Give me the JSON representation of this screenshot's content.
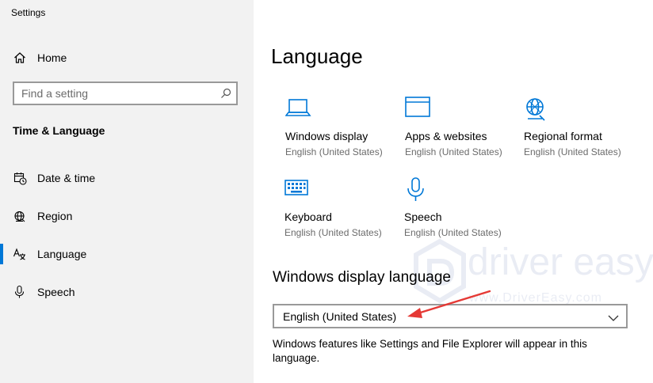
{
  "window": {
    "title": "Settings"
  },
  "sidebar": {
    "home_label": "Home",
    "search_placeholder": "Find a setting",
    "section_heading": "Time & Language",
    "items": [
      {
        "label": "Date & time",
        "icon": "calendar-clock-icon"
      },
      {
        "label": "Region",
        "icon": "globe-icon"
      },
      {
        "label": "Language",
        "icon": "language-icon",
        "active": true
      },
      {
        "label": "Speech",
        "icon": "microphone-icon"
      }
    ]
  },
  "main": {
    "title": "Language",
    "tiles": [
      {
        "name": "Windows display",
        "sub": "English (United States)",
        "icon": "laptop-icon"
      },
      {
        "name": "Apps & websites",
        "sub": "English (United States)",
        "icon": "browser-window-icon"
      },
      {
        "name": "Regional format",
        "sub": "English (United States)",
        "icon": "globe-icon"
      },
      {
        "name": "Keyboard",
        "sub": "English (United States)",
        "icon": "keyboard-icon"
      },
      {
        "name": "Speech",
        "sub": "English (United States)",
        "icon": "microphone-icon"
      }
    ],
    "display_language": {
      "title": "Windows display language",
      "selected": "English (United States)",
      "description": "Windows features like Settings and File Explorer will appear in this language."
    }
  },
  "watermark": {
    "text": "driver easy",
    "url": "www.DriverEasy.com"
  },
  "colors": {
    "accent": "#0078d7",
    "sidebar_bg": "#f2f2f2",
    "annotation": "#e53935",
    "muted_text": "#6b6b6b"
  }
}
